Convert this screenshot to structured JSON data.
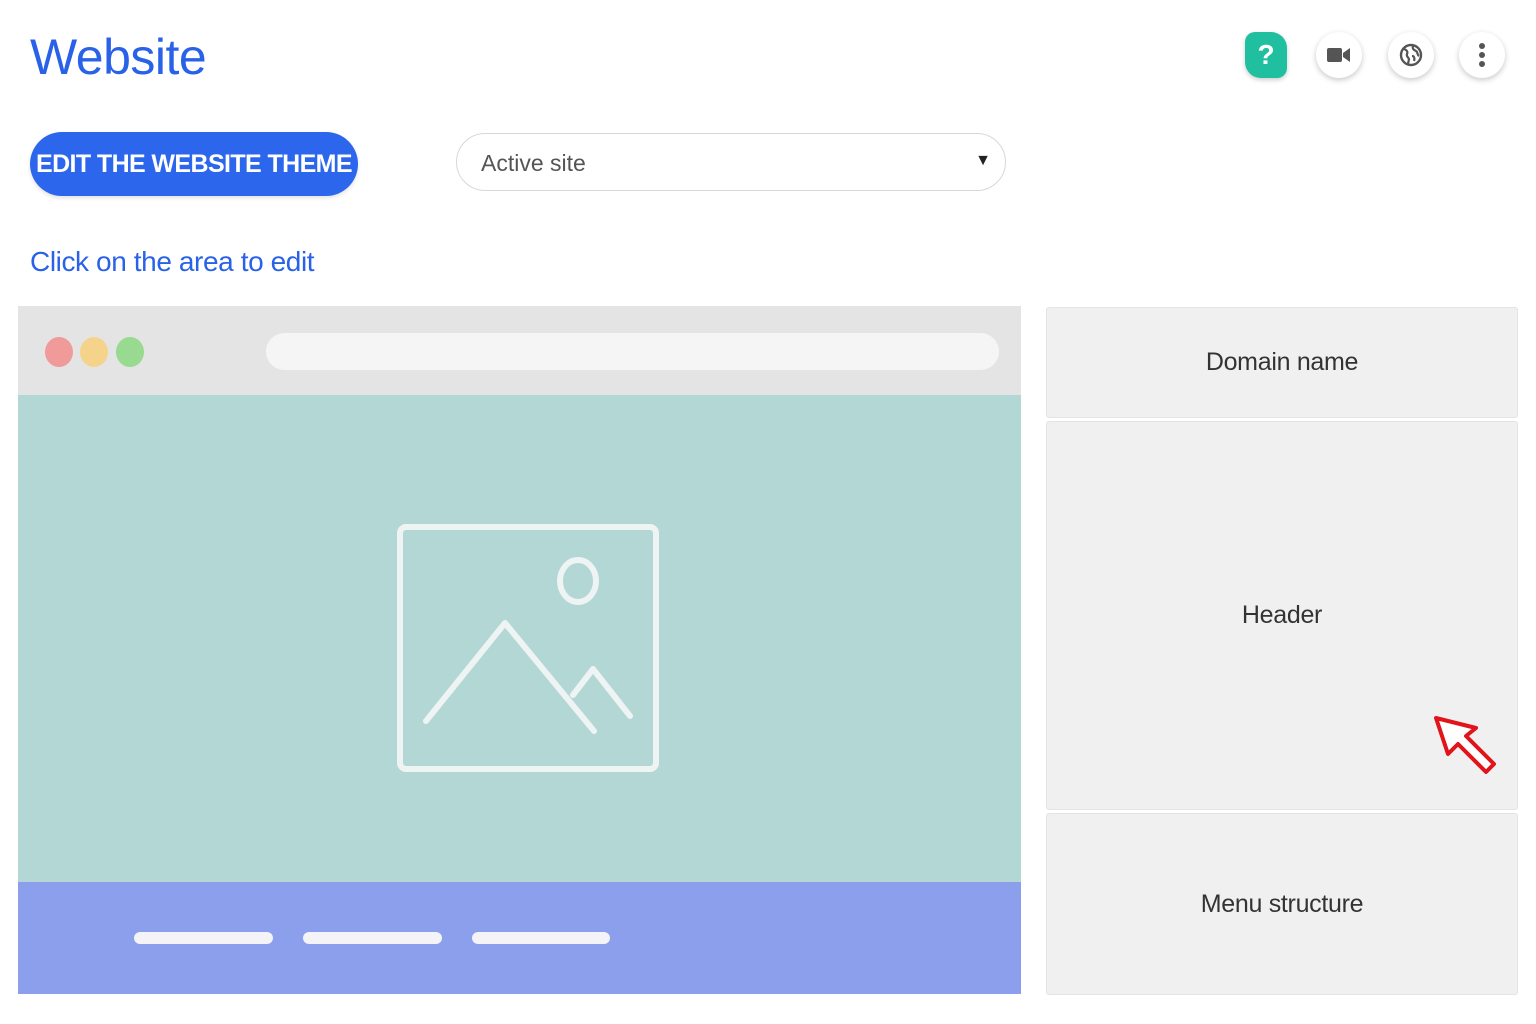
{
  "page": {
    "title": "Website",
    "accent_color": "#2962e8"
  },
  "toolbar": {
    "help_label": "?",
    "help_icon": "help-icon",
    "video_icon": "video-camera-icon",
    "globe_icon": "globe-icon",
    "more_icon": "more-vertical-icon"
  },
  "actions": {
    "edit_theme_label": "EDIT THE WEBSITE THEME"
  },
  "site_select": {
    "value": "Active site",
    "caret": "▼"
  },
  "hint": "Click on the area to edit",
  "browser_mock": {
    "dot_colors": [
      "#f09a9a",
      "#f6d38b",
      "#98da8f"
    ],
    "hero_color": "#b3d7d5",
    "footer_color": "#8b9fec",
    "hero_icon": "image-placeholder-icon"
  },
  "sections": {
    "domain_name": "Domain name",
    "header": "Header",
    "menu_structure": "Menu structure"
  },
  "cursor_icon": "arrow-cursor-icon"
}
